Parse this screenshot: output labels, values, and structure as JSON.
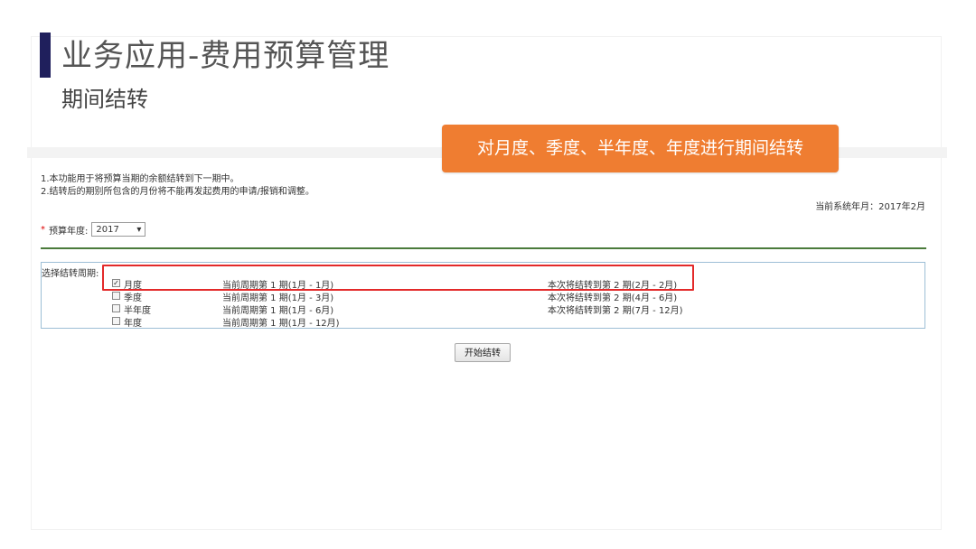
{
  "slide": {
    "title": "业务应用-费用预算管理",
    "subtitle": "期间结转"
  },
  "callout": {
    "text": "对月度、季度、半年度、年度进行期间结转"
  },
  "notes": {
    "line1": "1.本功能用于将预算当期的余额结转到下一期中。",
    "line2": "2.结转后的期别所包含的月份将不能再发起费用的申请/报销和调整。"
  },
  "system_date": "当前系统年月：2017年2月",
  "budget_year": {
    "required_mark": "*",
    "label": "预算年度:",
    "selected": "2017"
  },
  "period": {
    "label": "选择结转周期:",
    "rows": [
      {
        "name": "月度",
        "checked": true,
        "current": "当前周期第 1 期(1月 - 1月)",
        "next": "本次将结转到第 2 期(2月 - 2月)"
      },
      {
        "name": "季度",
        "checked": false,
        "current": "当前周期第 1 期(1月 - 3月)",
        "next": "本次将结转到第 2 期(4月 - 6月)"
      },
      {
        "name": "半年度",
        "checked": false,
        "current": "当前周期第 1 期(1月 - 6月)",
        "next": "本次将结转到第 2 期(7月 - 12月)"
      },
      {
        "name": "年度",
        "checked": false,
        "current": "当前周期第 1 期(1月 - 12月)",
        "next": ""
      }
    ]
  },
  "start_button": "开始结转",
  "colors": {
    "callout": "#ef7d31",
    "title_bar": "#1f1f5c",
    "highlight": "#e32a2a",
    "divider": "#4b7b3b"
  },
  "icons": {
    "checkbox_checked": "check-icon",
    "select_arrow": "caret-down-icon"
  }
}
